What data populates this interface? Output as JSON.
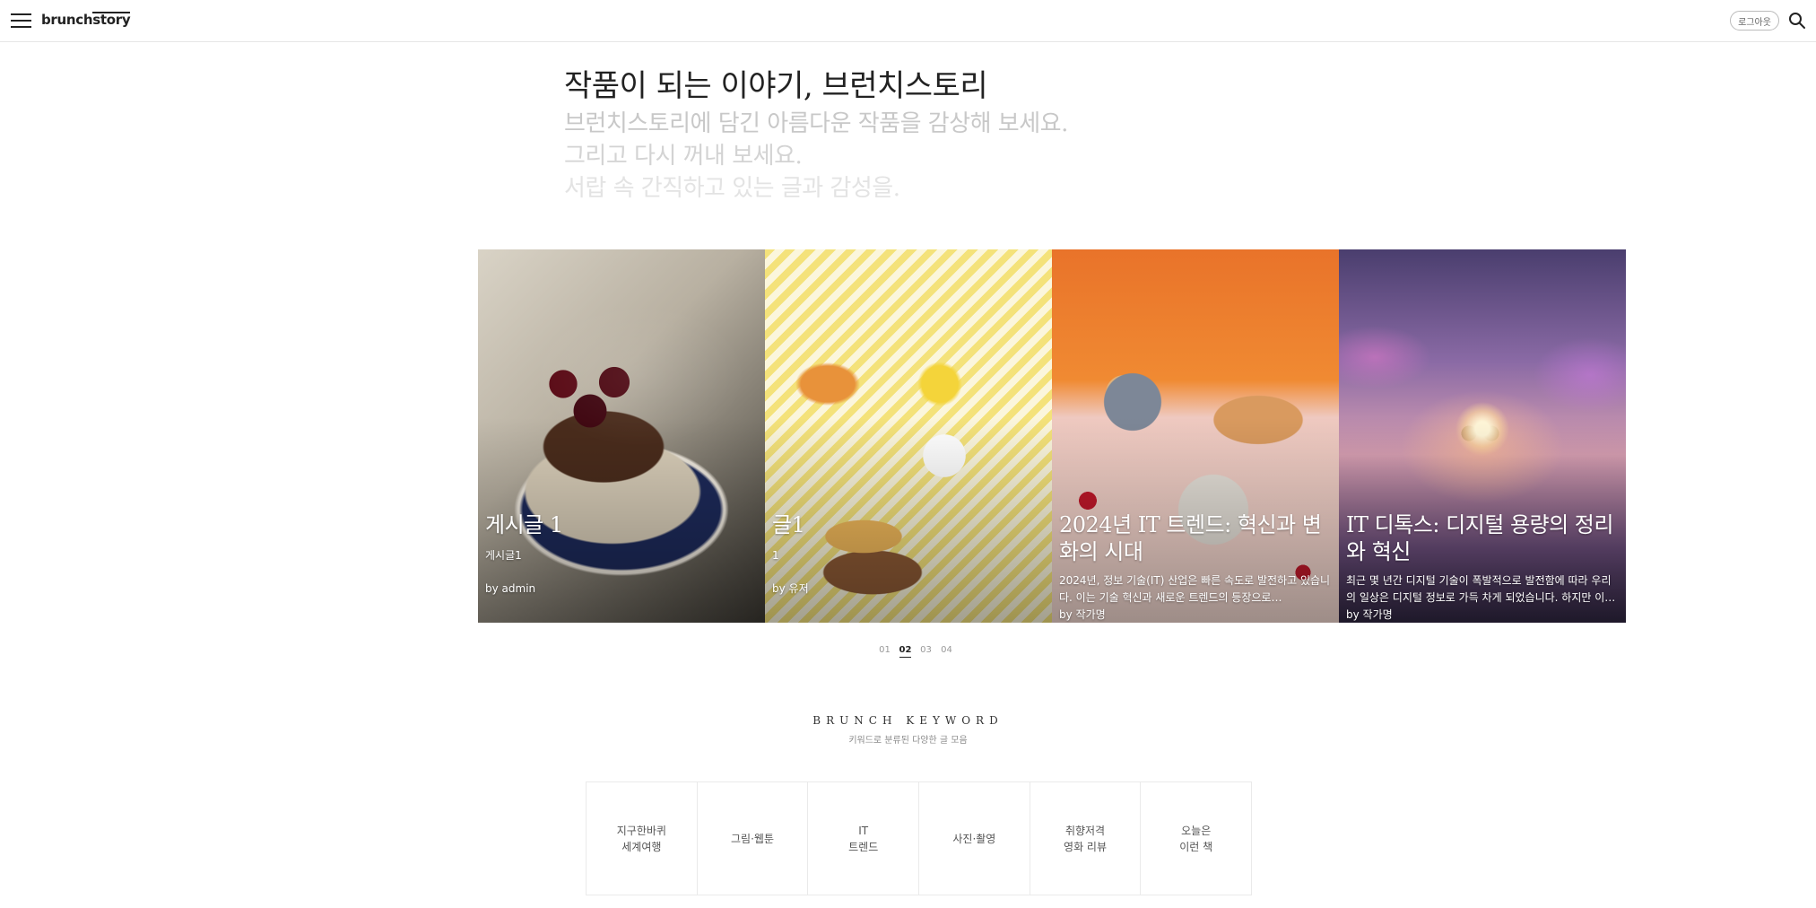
{
  "header": {
    "logo_part1": "brunch",
    "logo_part2": "story",
    "logout_label": "로그아웃"
  },
  "intro": {
    "title": "작품이 되는 이야기, 브런치스토리",
    "lines": [
      "브런치스토리에 담긴 아름다운 작품을 감상해 보세요.",
      "그리고 다시 꺼내 보세요.",
      "서랍 속 간직하고 있는 글과 감성을."
    ]
  },
  "cards": [
    {
      "title": "게시글 1",
      "subtitle": "게시글1",
      "description": "",
      "author": "by admin",
      "image": "cherry-chocolate-cake"
    },
    {
      "title": "글1",
      "subtitle": "1",
      "description": "",
      "author": "by 유저",
      "image": "dessert-buffet-tulips"
    },
    {
      "title": "2024년 IT 트렌드: 혁신과 변화의 시대",
      "subtitle": "",
      "description": "2024년, 정보 기술(IT) 산업은 빠른 속도로 발전하고 있습니다. 이는 기술 혁신과 새로운 트렌드의 등장으로…",
      "author": "by 작가명",
      "image": "pastries-orange-table"
    },
    {
      "title": "IT 디톡스: 디지털 용량의 정리와 혁신",
      "subtitle": "",
      "description": "최근 몇 년간 디지털 기술이 폭발적으로 발전함에 따라 우리의 일상은 디지털 정보로 가득 차게 되었습니다. 하지만 이러한…",
      "author": "by 작가명",
      "image": "fantasy-bridge-bears"
    }
  ],
  "pagination": {
    "pages": [
      "01",
      "02",
      "03",
      "04"
    ],
    "active": "02"
  },
  "keyword": {
    "title": "BRUNCH KEYWORD",
    "subtitle": "키워드로 분류된 다양한 글 모음",
    "items": [
      {
        "line1": "지구한바퀴",
        "line2": "세계여행"
      },
      {
        "line1": "그림·웹툰",
        "line2": ""
      },
      {
        "line1": "IT",
        "line2": "트렌드"
      },
      {
        "line1": "사진·촬영",
        "line2": ""
      },
      {
        "line1": "취향저격",
        "line2": "영화 리뷰"
      },
      {
        "line1": "오늘은",
        "line2": "이런 책"
      }
    ]
  },
  "icons": {
    "menu": "hamburger-menu-icon",
    "search": "search-icon"
  }
}
